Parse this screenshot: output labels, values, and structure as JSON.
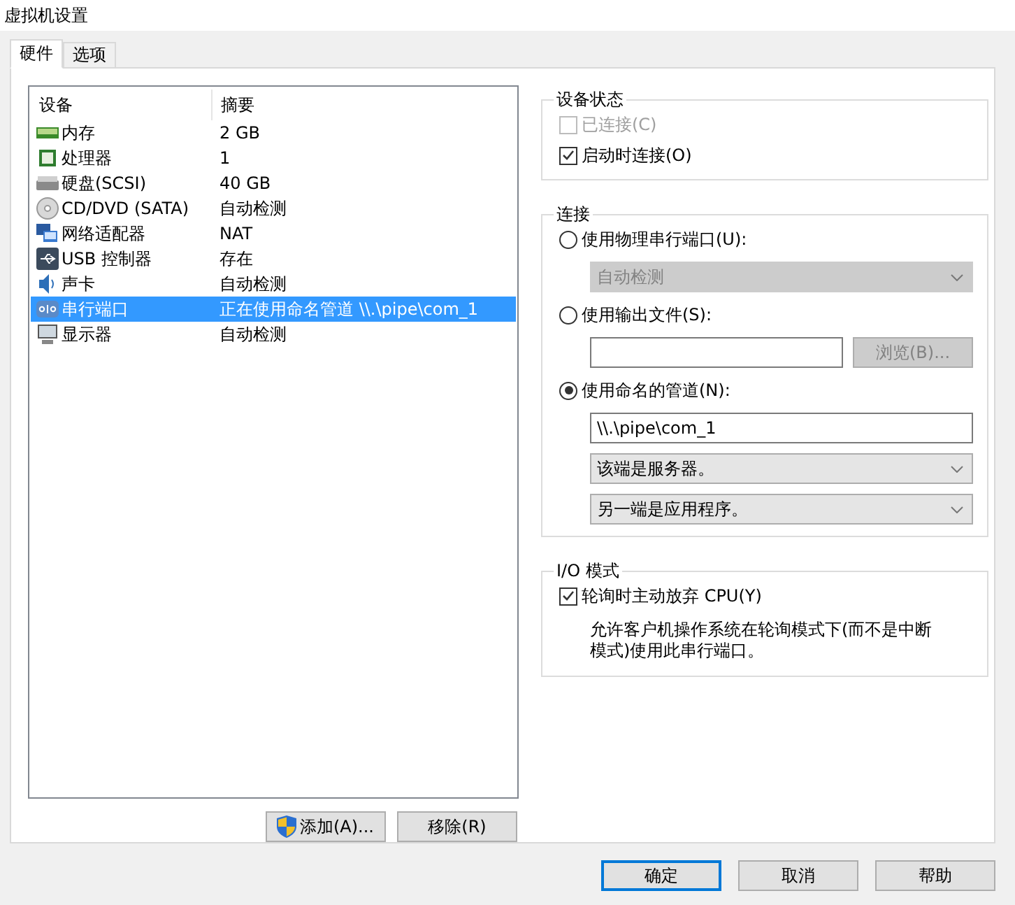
{
  "window": {
    "title": "虚拟机设置"
  },
  "tabs": [
    {
      "label": "硬件",
      "selected": true
    },
    {
      "label": "选项",
      "selected": false
    }
  ],
  "device_list": {
    "columns": [
      "设备",
      "摘要"
    ],
    "rows": [
      {
        "kind": "memory",
        "device": "内存",
        "summary": "2 GB",
        "selected": false
      },
      {
        "kind": "cpu",
        "device": "处理器",
        "summary": "1",
        "selected": false
      },
      {
        "kind": "disk",
        "device": "硬盘(SCSI)",
        "summary": "40 GB",
        "selected": false
      },
      {
        "kind": "cdrom",
        "device": "CD/DVD (SATA)",
        "summary": "自动检测",
        "selected": false
      },
      {
        "kind": "network",
        "device": "网络适配器",
        "summary": "NAT",
        "selected": false
      },
      {
        "kind": "usb",
        "device": "USB 控制器",
        "summary": "存在",
        "selected": false
      },
      {
        "kind": "sound",
        "device": "声卡",
        "summary": "自动检测",
        "selected": false
      },
      {
        "kind": "serial",
        "device": "串行端口",
        "summary": "正在使用命名管道 \\\\.\\pipe\\com_1",
        "selected": true
      },
      {
        "kind": "display",
        "device": "显示器",
        "summary": "自动检测",
        "selected": false
      }
    ]
  },
  "list_buttons": [
    {
      "kind": "shield",
      "label": "添加(A)..."
    },
    {
      "kind": "plain",
      "label": "移除(R)"
    }
  ],
  "device_status": {
    "title": "设备状态",
    "options": [
      {
        "label": "已连接(C)",
        "checked": false,
        "disabled": true
      },
      {
        "label": "启动时连接(O)",
        "checked": true,
        "disabled": false
      }
    ]
  },
  "connection": {
    "title": "连接",
    "items": [
      {
        "kind": "radio",
        "label": "使用物理串行端口(U):",
        "selected": false
      },
      {
        "kind": "select",
        "value": "自动检测",
        "disabled": true
      },
      {
        "kind": "radio",
        "label": "使用输出文件(S):",
        "selected": false
      },
      {
        "kind": "file",
        "button": "浏览(B)...",
        "disabled": true
      },
      {
        "kind": "radio",
        "label": "使用命名的管道(N):",
        "selected": true
      },
      {
        "kind": "text",
        "value": "\\\\.\\pipe\\com_1"
      },
      {
        "kind": "select",
        "value": "该端是服务器。",
        "disabled": false
      },
      {
        "kind": "select",
        "value": "另一端是应用程序。",
        "disabled": false
      }
    ]
  },
  "io_mode": {
    "title": "I/O 模式",
    "option": {
      "label": "轮询时主动放弃 CPU(Y)",
      "checked": true
    },
    "description": "允许客户机操作系统在轮询模式下(而不是中断模式)使用此串行端口。"
  },
  "buttons": [
    {
      "label": "确定",
      "default": true
    },
    {
      "label": "取消",
      "default": false
    },
    {
      "label": "帮助",
      "default": false
    }
  ]
}
